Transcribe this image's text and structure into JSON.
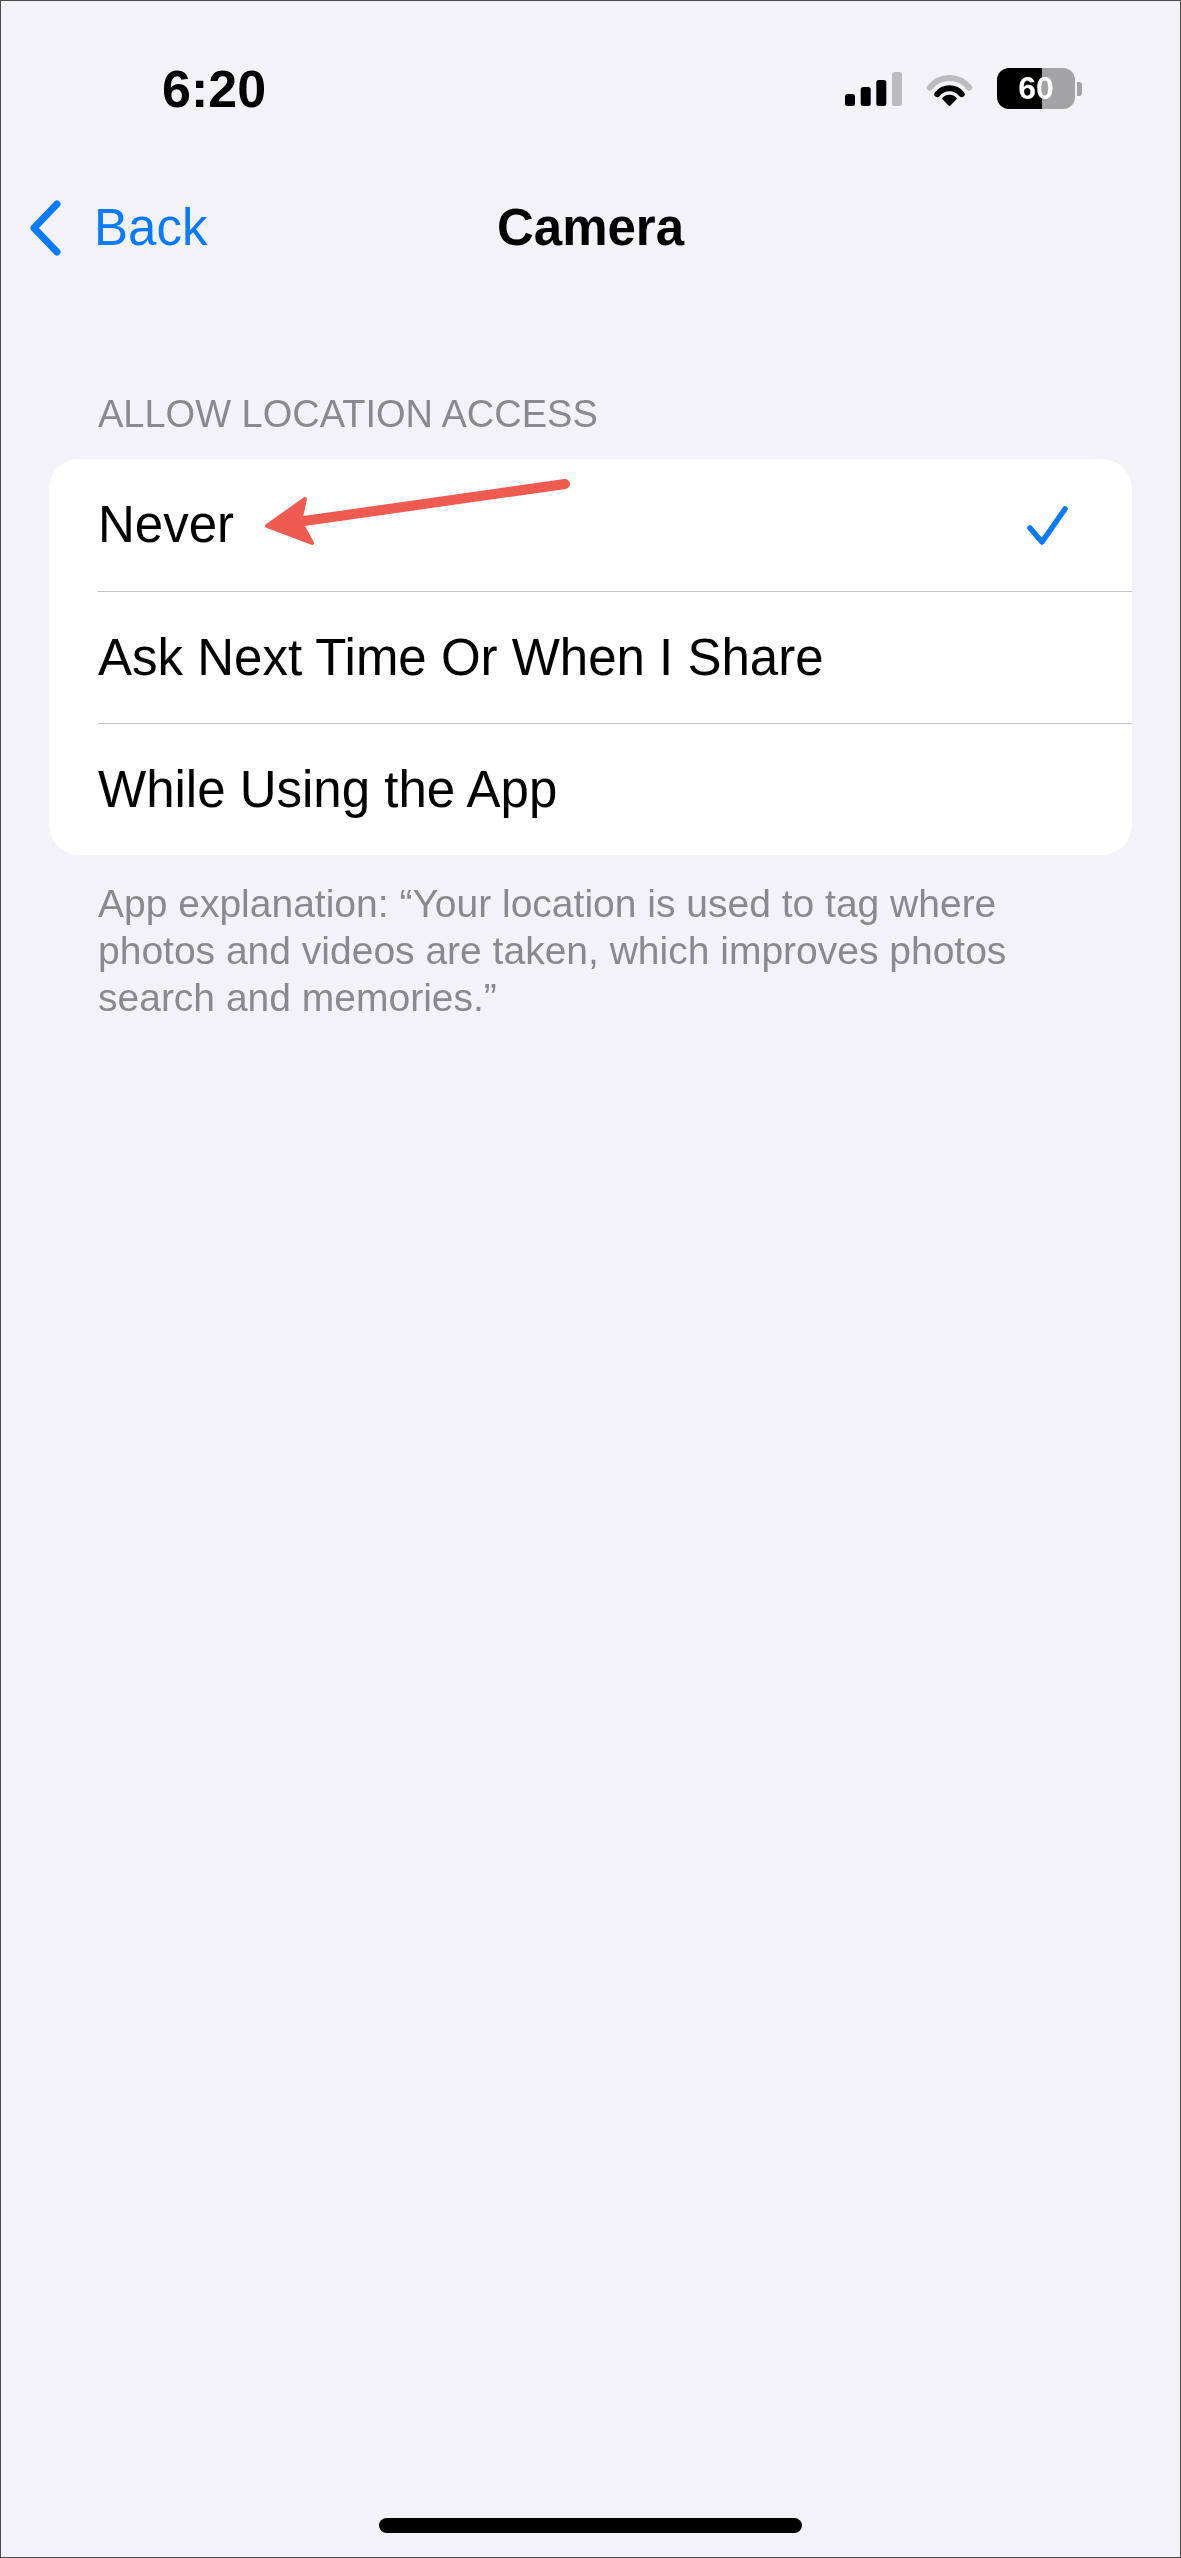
{
  "status_bar": {
    "time": "6:20",
    "battery": "60"
  },
  "nav_bar": {
    "back_label": "Back",
    "title": "Camera"
  },
  "section": {
    "header": "ALLOW LOCATION ACCESS",
    "options": [
      {
        "label": "Never",
        "selected": true,
        "annotated": true
      },
      {
        "label": "Ask Next Time Or When I Share",
        "selected": false,
        "annotated": false
      },
      {
        "label": "While Using the App",
        "selected": false,
        "annotated": false
      }
    ],
    "footer": "App explanation: “Your location is used to tag where photos and videos are taken, which improves photos search and memories.”"
  }
}
